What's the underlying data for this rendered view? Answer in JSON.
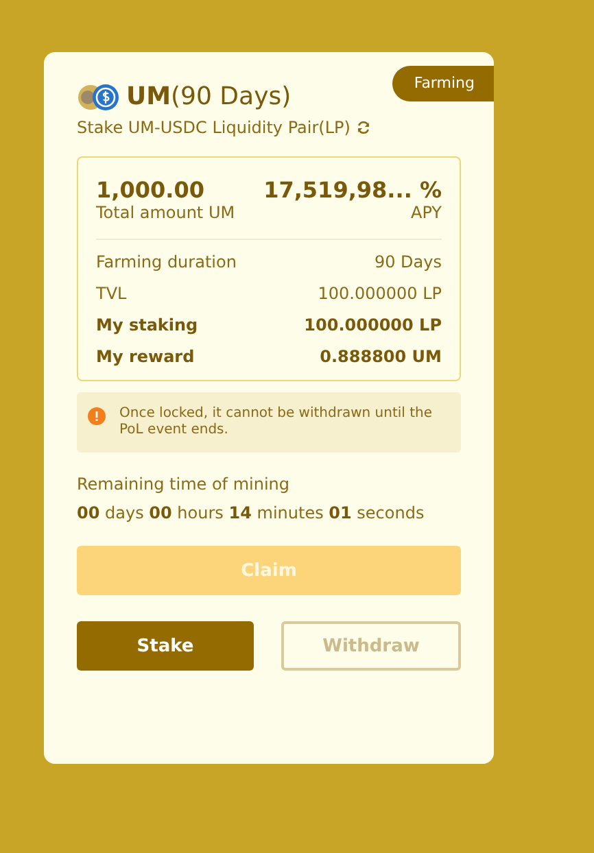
{
  "card": {
    "title": "UM",
    "title_suffix": "(90 Days)",
    "badge": "Farming",
    "subtitle": "Stake UM-USDC Liquidity Pair(LP)"
  },
  "summary": {
    "amount": "1,000.00",
    "amount_label": "Total amount UM",
    "apy": "17,519,98... %",
    "apy_label": "APY"
  },
  "details": [
    {
      "label": "Farming duration",
      "value": "90 Days",
      "emphasis": false
    },
    {
      "label": "TVL",
      "value": "100.000000 LP",
      "emphasis": false
    },
    {
      "label": "My staking",
      "value": "100.000000 LP",
      "emphasis": true
    },
    {
      "label": "My reward",
      "value": "0.888800 UM",
      "emphasis": true
    }
  ],
  "notice": "Once locked, it cannot be withdrawn until the PoL event ends.",
  "countdown": {
    "label": "Remaining time of mining",
    "text": "**00** days **00** hours **14** minutes **01** seconds"
  },
  "buttons": [
    {
      "label": "Claim",
      "kind": "wide",
      "disabled": true
    },
    {
      "label": "Stake",
      "kind": "primary",
      "disabled": false
    },
    {
      "label": "Withdraw",
      "kind": "outline",
      "disabled": true
    }
  ]
}
